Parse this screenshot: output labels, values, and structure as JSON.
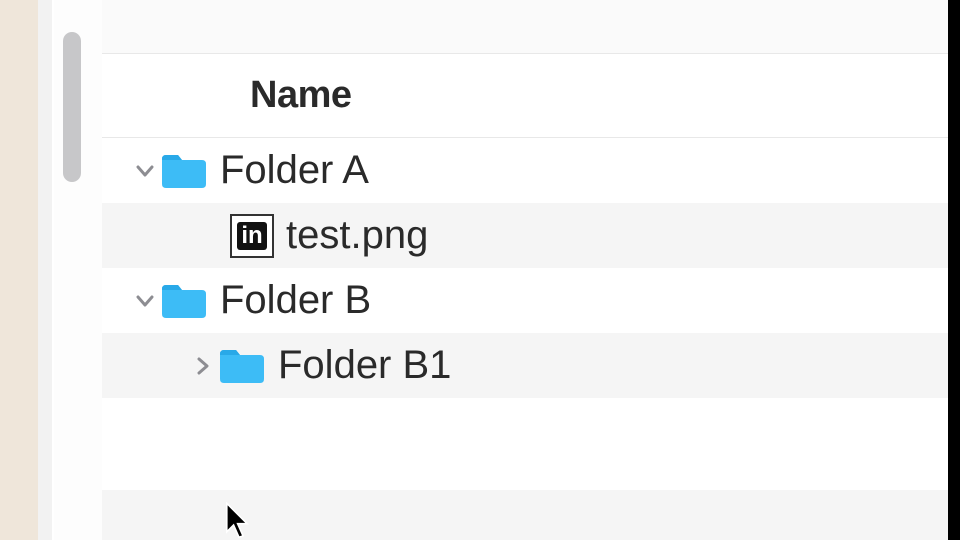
{
  "header": {
    "column_label": "Name"
  },
  "rows": [
    {
      "type": "folder",
      "name": "Folder A",
      "expanded": true,
      "level": 0,
      "alt": false
    },
    {
      "type": "file",
      "name": "test.png",
      "icon": "in",
      "level": 1,
      "alt": true
    },
    {
      "type": "folder",
      "name": "Folder B",
      "expanded": true,
      "level": 0,
      "alt": false
    },
    {
      "type": "folder",
      "name": "Folder B1",
      "expanded": false,
      "level": 1,
      "alt": true
    }
  ],
  "colors": {
    "folder": "#3dbcf6",
    "folder_tab": "#29a9e8"
  }
}
